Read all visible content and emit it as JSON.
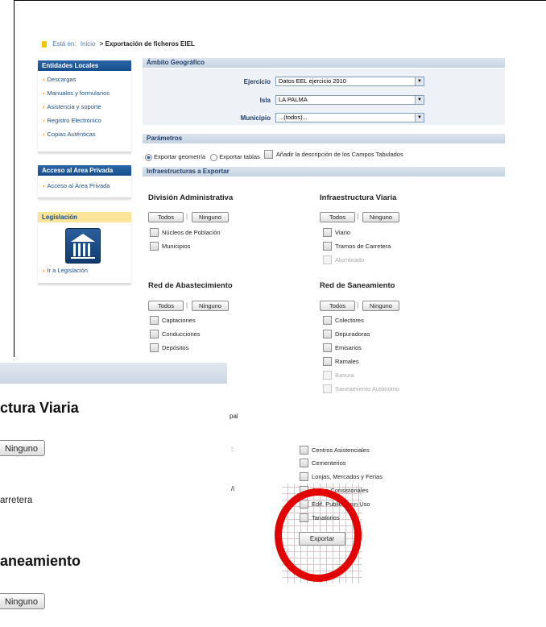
{
  "breadcrumb": {
    "prefix": "Está en:",
    "home": "Inicio",
    "sep": ">",
    "current": "Exportación de ficheros EIEL"
  },
  "sidebar": {
    "entidades": {
      "title": "Entidades Locales",
      "items": [
        "Descargas",
        "Manuales y formularios",
        "Asistencia y soporte",
        "Registro Electrónico",
        "Copias Auténticas"
      ]
    },
    "acceso": {
      "title": "Acceso al Area Privada",
      "items": [
        "Acceso al Área Privada"
      ]
    },
    "legislacion": {
      "title": "Legislación",
      "link": "Ir a Legislación"
    }
  },
  "ambito": {
    "title": "Ámbito Geográfico",
    "ejercicio_label": "Ejercicio",
    "ejercicio_value": "Datos EEL ejercicio 2010",
    "isla_label": "Isla",
    "isla_value": "LA PALMA",
    "municipio_label": "Municipio",
    "municipio_value": "...(todos)..."
  },
  "parametros": {
    "title": "Parámetros",
    "opt_geometria": "Exportar geometría",
    "opt_tablas": "Exportar tablas",
    "opt_descripcion": "Añadir la descripción de los Campos Tabulados",
    "selected": "Exportar geometría"
  },
  "infra": {
    "title": "Infraestructuras a Exportar",
    "todos": "Todos",
    "ninguno": "Ninguno",
    "sep": "|",
    "division": {
      "title": "División Administrativa",
      "items": [
        "Núcleos de Población",
        "Municipios"
      ]
    },
    "viaria": {
      "title": "Infraestructura Viaria",
      "items": [
        "Viario",
        "Tramos de Carretera"
      ],
      "disabled": [
        "Alumbrado"
      ]
    },
    "abastecimiento": {
      "title": "Red de Abastecimiento",
      "items": [
        "Captaciones",
        "Conducciones",
        "Depósitos"
      ]
    },
    "saneamiento": {
      "title": "Red de Saneamiento",
      "items": [
        "Colectores",
        "Depuradoras",
        "Emisarios",
        "Ramales"
      ],
      "disabled": [
        "Basura",
        "Saneamiento Autónomo"
      ]
    },
    "equipamientos": {
      "items": [
        "Centros Asistenciales",
        "Cementerios",
        "Lonjas, Mercados y Ferias",
        "Casas Consistoriales",
        "Edif. Publicos sin Uso",
        "Tanatorios"
      ]
    },
    "fragments": [
      "pal",
      ":",
      "/i"
    ],
    "export_label": "Exportar"
  },
  "zoom": {
    "title1": "ctura Viaria",
    "button1": "Ninguno",
    "text1": "arretera",
    "title2": "aneamiento",
    "button2": "Ninguno"
  },
  "colors": {
    "highlight_ring": "#e20000",
    "header_blue": "#174d8c",
    "accent_orange": "#f08c00"
  }
}
